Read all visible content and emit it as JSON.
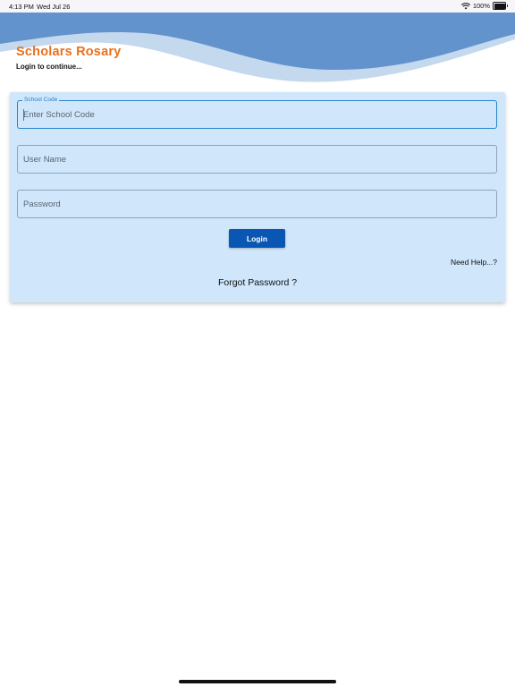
{
  "status_bar": {
    "time": "4:13 PM",
    "date": "Wed Jul 26",
    "battery": "100%",
    "wifi_icon": "wifi-icon",
    "battery_icon": "battery-icon"
  },
  "header": {
    "title": "Scholars Rosary",
    "subtitle": "Login to continue...",
    "colors": {
      "title": "#e8711f",
      "wave_dark": "#6393cd",
      "wave_light": "#c4d8ee"
    }
  },
  "form": {
    "school_code": {
      "label": "School Code",
      "placeholder": "Enter School Code",
      "value": ""
    },
    "username": {
      "placeholder": "User Name",
      "value": ""
    },
    "password": {
      "placeholder": "Password",
      "value": ""
    },
    "login_label": "Login",
    "need_help": "Need Help...?",
    "forgot_password": "Forgot Password ?",
    "colors": {
      "card_bg": "#cfe6fb",
      "button_bg": "#0a57b3",
      "focus": "#2a84c9"
    }
  }
}
